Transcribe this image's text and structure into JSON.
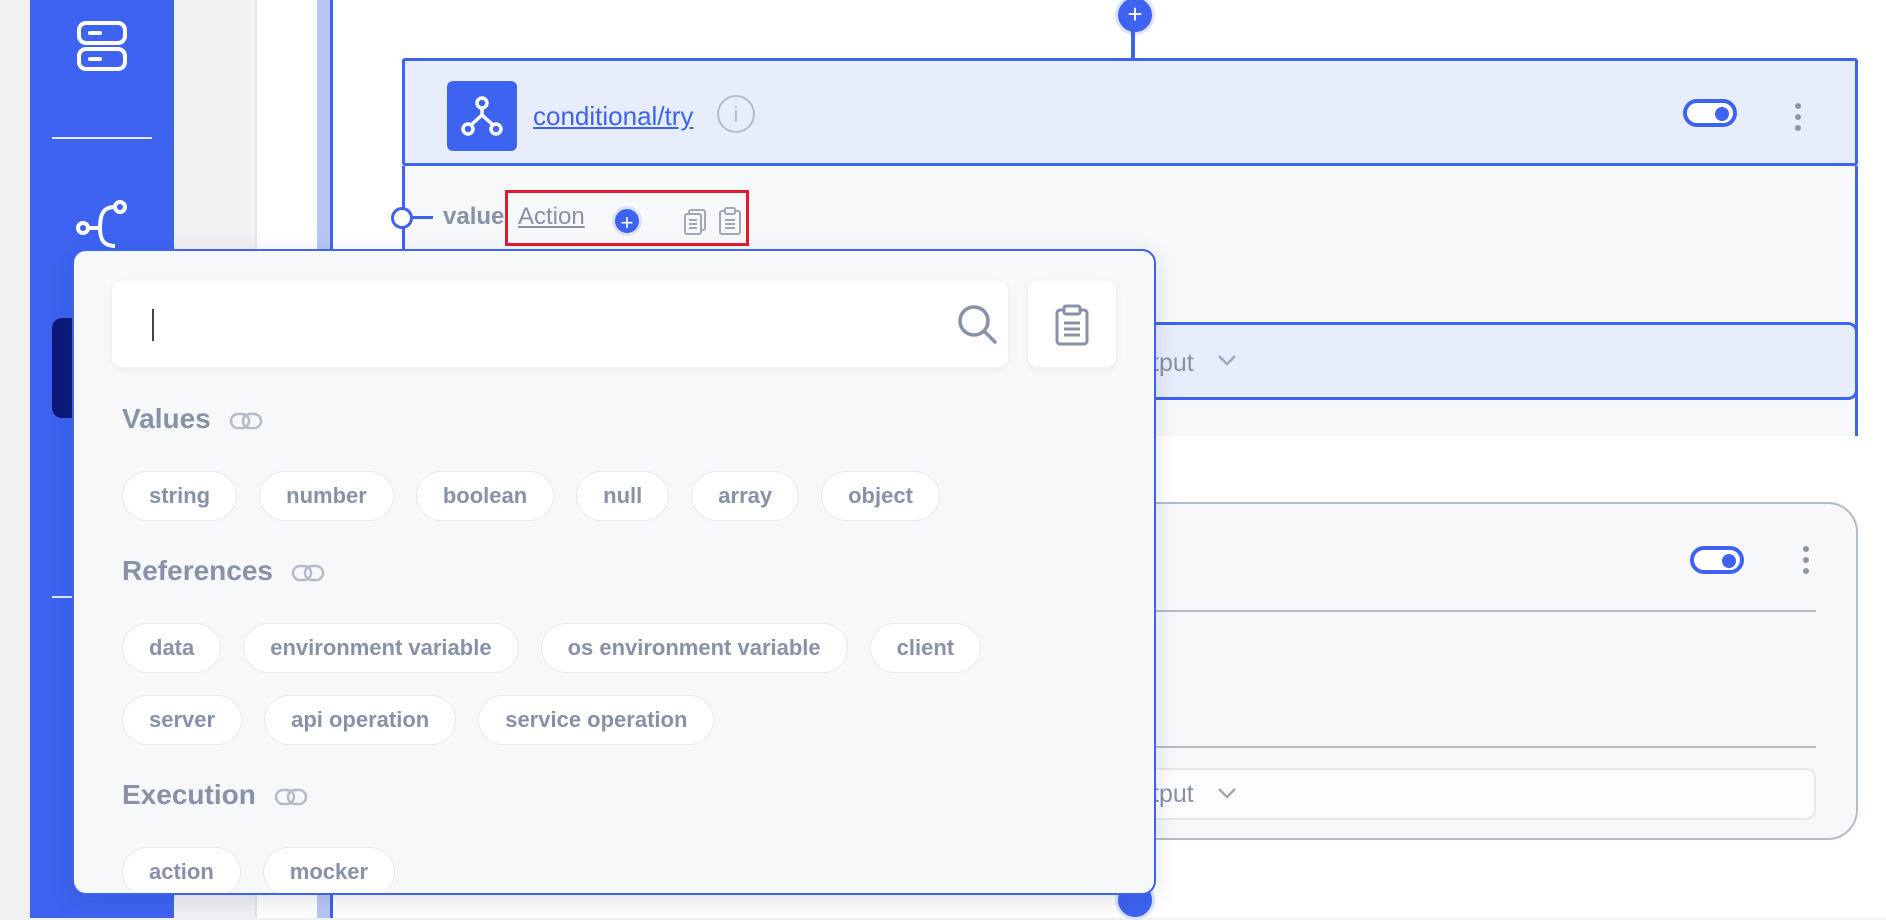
{
  "node": {
    "title": "conditional/try",
    "value_label": "value",
    "action_label": "Action",
    "output_label": "tput",
    "second_output_label": "tput"
  },
  "popup": {
    "search": {
      "value": "",
      "placeholder": ""
    },
    "sections": [
      {
        "title": "Values",
        "chips": [
          "string",
          "number",
          "boolean",
          "null",
          "array",
          "object"
        ]
      },
      {
        "title": "References",
        "chips": [
          "data",
          "environment variable",
          "os environment variable",
          "client",
          "server",
          "api operation",
          "service operation"
        ]
      },
      {
        "title": "Execution",
        "chips": [
          "action",
          "mocker"
        ]
      }
    ]
  },
  "colors": {
    "accent": "#3d63f0",
    "highlight": "#e21b2e",
    "muted_text": "#8791a8"
  },
  "icons": [
    "database-icon",
    "flow-icon",
    "branch-icon",
    "info-icon",
    "toggle-icon",
    "kebab-icon",
    "add-icon",
    "copy-icon",
    "paste-icon",
    "search-icon",
    "link-icon",
    "chevron-down-icon"
  ]
}
